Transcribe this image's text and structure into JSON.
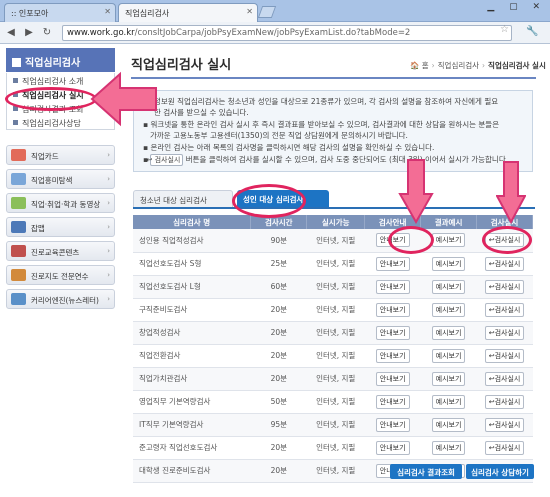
{
  "browser": {
    "tabs": [
      {
        "title": ":: 인포모아"
      },
      {
        "title": "직업심리검사"
      }
    ],
    "url_host": "www.work.go.kr",
    "url_path": "/consltJobCarpa/jobPsyExamNew/jobPsyExamList.do?tabMode=2"
  },
  "sidebar": {
    "title": "직업심리검사",
    "items": [
      {
        "label": "직업심리검사 소개"
      },
      {
        "label": "직업심리검사 실시"
      },
      {
        "label": "심리검사결과 조회"
      },
      {
        "label": "직업심리검사상담"
      }
    ],
    "banners": [
      {
        "label": "직업카드"
      },
      {
        "label": "직업흥미탐색"
      },
      {
        "label": "직업·취업·학과 동영상"
      },
      {
        "label": "잡맵"
      },
      {
        "label": "진로교육콘텐츠"
      },
      {
        "label": "진로지도 전문연수"
      },
      {
        "label": "커리어엔진(뉴스레터)"
      }
    ]
  },
  "page": {
    "title": "직업심리검사 실시",
    "breadcrumb": [
      "홈",
      "직업심리검사",
      "직업심리검사 실시"
    ]
  },
  "info": {
    "line1": "정보원 직업심리검사는 청소년과 성인을 대상으로 21종류가 있으며, 각 검사의 설명을 참조하여 자신에게 필요",
    "line2": "한 검사를 받으실 수 있습니다.",
    "bullet1": "워크넷을 통한 온라인 검사 실시 후 즉시 결과표를 받아보실 수 있으며, 검사결과에 대한 상담을 원하시는 분들은",
    "bullet1b": "가까운 고용노동부 고용센터(1350)의 전문 직업 상담원에게 문의하시기 바랍니다.",
    "bullet2": "온라인 검사는 아래 목록의 검사명을 클릭하시면 해당 검사의 설명을 확인하실 수 있습니다.",
    "bullet3_btn": "검사실시",
    "bullet3": "버튼을 클릭하여 검사를 실시할 수 있으며, 검사 도중 중단되어도 (최대 3일) 이어서 실시가 가능합니다."
  },
  "tabs": [
    {
      "label": "청소년 대상 심리검사"
    },
    {
      "label": "성인 대상 심리검사"
    }
  ],
  "table": {
    "headers": [
      "심리검사 명",
      "검사시간",
      "실시가능",
      "검사안내",
      "결과예시",
      "검사실시"
    ],
    "guide_btn": "안내보기",
    "example_btn": "예시보기",
    "run_btn": "검사실시",
    "rows": [
      {
        "name": "성인용 직업적성검사",
        "time": "90분",
        "avail": "인터넷, 지필"
      },
      {
        "name": "직업선호도검사 S형",
        "time": "25분",
        "avail": "인터넷, 지필"
      },
      {
        "name": "직업선호도검사 L형",
        "time": "60분",
        "avail": "인터넷, 지필"
      },
      {
        "name": "구직준비도검사",
        "time": "20분",
        "avail": "인터넷, 지필"
      },
      {
        "name": "창업적성검사",
        "time": "20분",
        "avail": "인터넷, 지필"
      },
      {
        "name": "직업전환검사",
        "time": "20분",
        "avail": "인터넷, 지필"
      },
      {
        "name": "직업가치관검사",
        "time": "20분",
        "avail": "인터넷, 지필"
      },
      {
        "name": "영업직무 기본역량검사",
        "time": "50분",
        "avail": "인터넷, 지필"
      },
      {
        "name": "IT직무 기본역량검사",
        "time": "95분",
        "avail": "인터넷, 지필"
      },
      {
        "name": "준고령자 직업선호도검사",
        "time": "20분",
        "avail": "인터넷, 지필"
      },
      {
        "name": "대학생 진로준비도검사",
        "time": "20분",
        "avail": "인터넷, 지필"
      }
    ]
  },
  "bottom_buttons": [
    {
      "label": "심리검사 결과조회"
    },
    {
      "label": "심리검사 상담하기"
    }
  ],
  "colors": {
    "accent": "#1d74c4",
    "header": "#5773b7",
    "annotation": "#e0245e"
  }
}
